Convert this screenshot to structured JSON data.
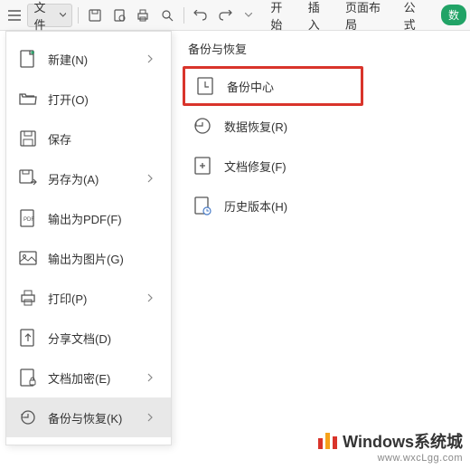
{
  "toolbar": {
    "file_label": "文件",
    "tabs": [
      "开始",
      "插入",
      "页面布局",
      "公式"
    ],
    "green_tab": "数"
  },
  "menu": {
    "items": [
      {
        "label": "新建(N)",
        "arrow": true
      },
      {
        "label": "打开(O)"
      },
      {
        "label": "保存"
      },
      {
        "label": "另存为(A)",
        "arrow": true
      },
      {
        "label": "输出为PDF(F)"
      },
      {
        "label": "输出为图片(G)"
      },
      {
        "label": "打印(P)",
        "arrow": true
      },
      {
        "label": "分享文档(D)"
      },
      {
        "label": "文档加密(E)",
        "arrow": true
      },
      {
        "label": "备份与恢复(K)",
        "arrow": true,
        "active": true
      }
    ]
  },
  "submenu": {
    "header": "备份与恢复",
    "items": [
      {
        "label": "备份中心",
        "highlight": true
      },
      {
        "label": "数据恢复(R)"
      },
      {
        "label": "文档修复(F)"
      },
      {
        "label": "历史版本(H)"
      }
    ]
  },
  "watermark": {
    "title": "Windows系统城",
    "url": "www.wxcLgg.com"
  }
}
